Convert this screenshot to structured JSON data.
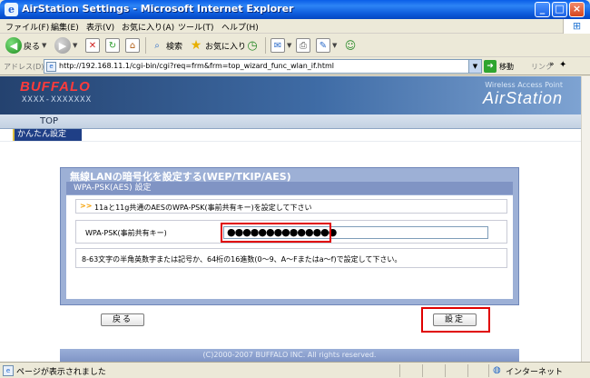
{
  "window": {
    "title": "AirStation Settings - Microsoft Internet Explorer",
    "minimize_icon": "minimize-icon",
    "maximize_icon": "maximize-icon",
    "close_icon": "close-icon"
  },
  "menubar": {
    "items": [
      "ファイル(F)",
      "編集(E)",
      "表示(V)",
      "お気に入り(A)",
      "ツール(T)",
      "ヘルプ(H)"
    ]
  },
  "toolbar": {
    "back": "戻る",
    "search": "検索",
    "favorites": "お気に入り"
  },
  "address": {
    "label": "アドレス(D)",
    "url": "http://192.168.11.1/cgi-bin/cgi?req=frm&frm=top_wizard_func_wlan_if.html",
    "go": "移動",
    "links": "リンク"
  },
  "banner": {
    "brand": "BUFFALO",
    "model": "XXXX-XXXXXXX",
    "product_line": "Wireless Access Point",
    "product": "AirStation"
  },
  "nav": {
    "tab_top": "TOP",
    "subtab": "かんたん設定"
  },
  "panel": {
    "title": "無線LANの暗号化を設定する(WEP/TKIP/AES)",
    "subtitle": "WPA-PSK(AES) 設定",
    "hint": "11aと11g共通のAESのWPA-PSK(事前共有キー)を設定して下さい",
    "psk_label": "WPA-PSK(事前共有キー)",
    "psk_value": "●●●●●●●●●●●●●●",
    "note": "8-63文字の半角英数字または記号か、64桁の16進数(0～9、A～Fまたはa～f)で設定して下さい。"
  },
  "buttons": {
    "back": "戻る",
    "set": "設定"
  },
  "footer": {
    "copyright": "(C)2000-2007 BUFFALO INC. All rights reserved."
  },
  "status": {
    "text": "ページが表示されました",
    "zone": "インターネット"
  }
}
